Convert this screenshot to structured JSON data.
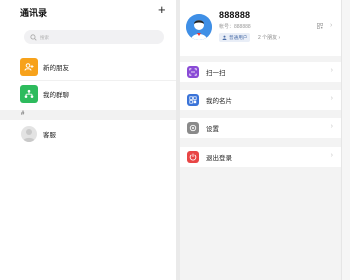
{
  "contacts": {
    "title": "通讯录",
    "add_icon": "plus-icon",
    "search": {
      "placeholder": "搜索"
    },
    "items": [
      {
        "label": "新的朋友",
        "icon": "add-friend-icon",
        "color": "#f7a21b"
      },
      {
        "label": "我的群聊",
        "icon": "group-chat-icon",
        "color": "#2dbb5d"
      }
    ],
    "section": "#",
    "entries": [
      {
        "label": "客服",
        "icon": "default-avatar-icon"
      }
    ]
  },
  "profile": {
    "name": "888888",
    "account": "帐号：888888",
    "badge": "普通用户",
    "friends": "2 个朋友 ›"
  },
  "menu": [
    {
      "label": "扫一扫",
      "icon": "scan-icon",
      "color": "#8a4bd6"
    },
    {
      "label": "我的名片",
      "icon": "business-card-icon",
      "color": "#3a73d8"
    },
    {
      "label": "设置",
      "icon": "settings-icon",
      "color": "#8a8a8a"
    },
    {
      "label": "退出登录",
      "icon": "logout-icon",
      "color": "#e84545"
    }
  ]
}
